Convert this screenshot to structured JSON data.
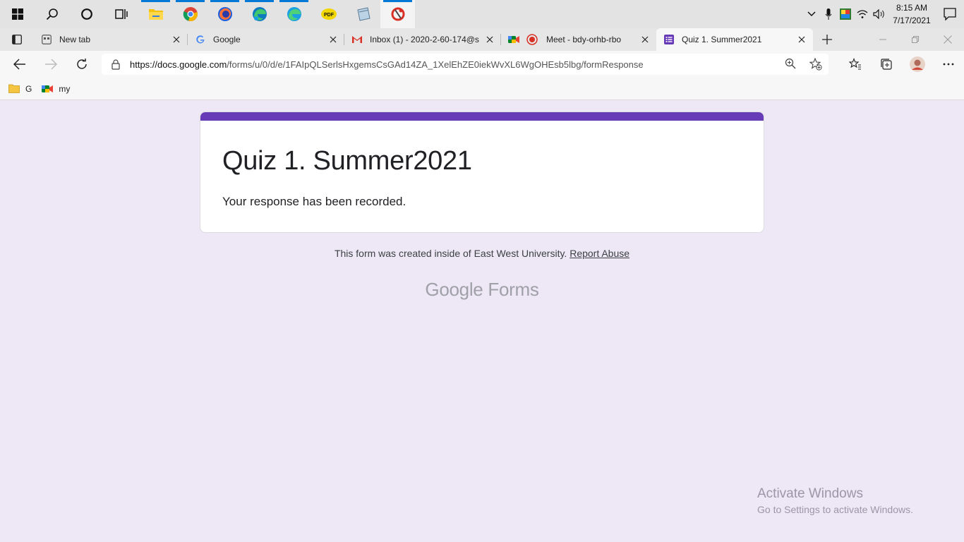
{
  "taskbar": {
    "apps": [
      {
        "name": "start-icon"
      },
      {
        "name": "search-icon"
      },
      {
        "name": "cortana-icon"
      },
      {
        "name": "task-view-icon"
      },
      {
        "name": "file-explorer-icon"
      },
      {
        "name": "chrome-icon"
      },
      {
        "name": "firefox-icon"
      },
      {
        "name": "edge-icon"
      },
      {
        "name": "edge-beta-icon"
      },
      {
        "name": "pdf-icon"
      },
      {
        "name": "notepad-icon"
      },
      {
        "name": "app-red-icon"
      }
    ],
    "clock_time": "8:15 AM",
    "clock_date": "7/17/2021"
  },
  "tabs": [
    {
      "title": "New tab"
    },
    {
      "title": "Google"
    },
    {
      "title": "Inbox (1) - 2020-2-60-174@s"
    },
    {
      "title": "Meet - bdy-orhb-rbo"
    },
    {
      "title": "Quiz 1. Summer2021"
    }
  ],
  "address": {
    "url_host": "https://docs.google.com",
    "url_path": "/forms/u/0/d/e/1FAIpQLSerlsHxgemsCsGAd14ZA_1XelEhZE0iekWvXL6WgOHEsb5lbg/formResponse"
  },
  "favorites": [
    {
      "label": "G"
    },
    {
      "label": "my"
    }
  ],
  "form": {
    "title": "Quiz 1. Summer2021",
    "message": "Your response has been recorded.",
    "accent_color": "#673ab7"
  },
  "footer": {
    "note": "This form was created inside of East West University.",
    "report_link": "Report Abuse",
    "brand_google": "Google",
    "brand_forms": "Forms"
  },
  "watermark": {
    "line1": "Activate Windows",
    "line2": "Go to Settings to activate Windows."
  }
}
